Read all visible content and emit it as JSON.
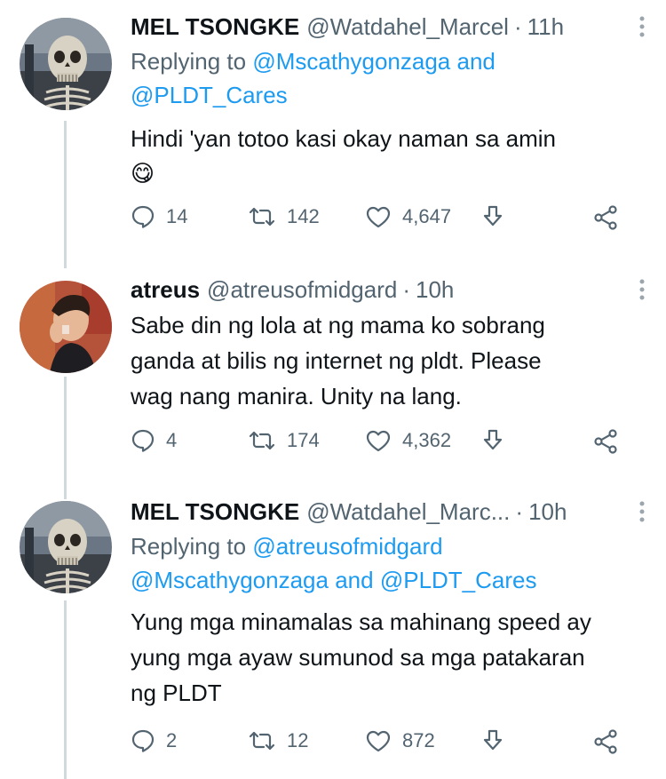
{
  "tweets": [
    {
      "name": "MEL TSONGKE",
      "handle": "@Watdahel_Marcel",
      "time": "11h",
      "replying_prefix": "Replying to",
      "replying_mentions": [
        "@Mscathygonzaga",
        "@PLDT_Cares"
      ],
      "replying_joiner": "and",
      "text_lines": [
        "Hindi 'yan totoo kasi okay naman sa amin"
      ],
      "emoji": "😋",
      "replies": "14",
      "retweets": "142",
      "likes": "4,647"
    },
    {
      "name": "atreus",
      "handle": "@atreusofmidgard",
      "time": "10h",
      "text_lines": [
        "Sabe din ng lola at ng mama ko sobrang",
        "ganda at bilis ng internet ng pldt. Please",
        "wag nang manira. Unity na lang."
      ],
      "replies": "4",
      "retweets": "174",
      "likes": "4,362"
    },
    {
      "name": "MEL TSONGKE",
      "handle": "@Watdahel_Marc...",
      "time": "10h",
      "replying_prefix": "Replying to",
      "replying_mentions": [
        "@atreusofmidgard",
        "@Mscathygonzaga",
        "@PLDT_Cares"
      ],
      "replying_joiner": "and",
      "text_lines": [
        "Yung mga minamalas sa mahinang speed ay",
        "yung mga ayaw sumunod sa mga patakaran",
        "ng PLDT"
      ],
      "replies": "2",
      "retweets": "12",
      "likes": "872"
    }
  ],
  "colors": {
    "text": "#0f1419",
    "secondary": "#536471",
    "link": "#1d9bf0",
    "thread": "#cfd9de"
  },
  "icons": [
    "reply-icon",
    "retweet-icon",
    "like-icon",
    "download-icon",
    "share-icon",
    "more-icon"
  ]
}
